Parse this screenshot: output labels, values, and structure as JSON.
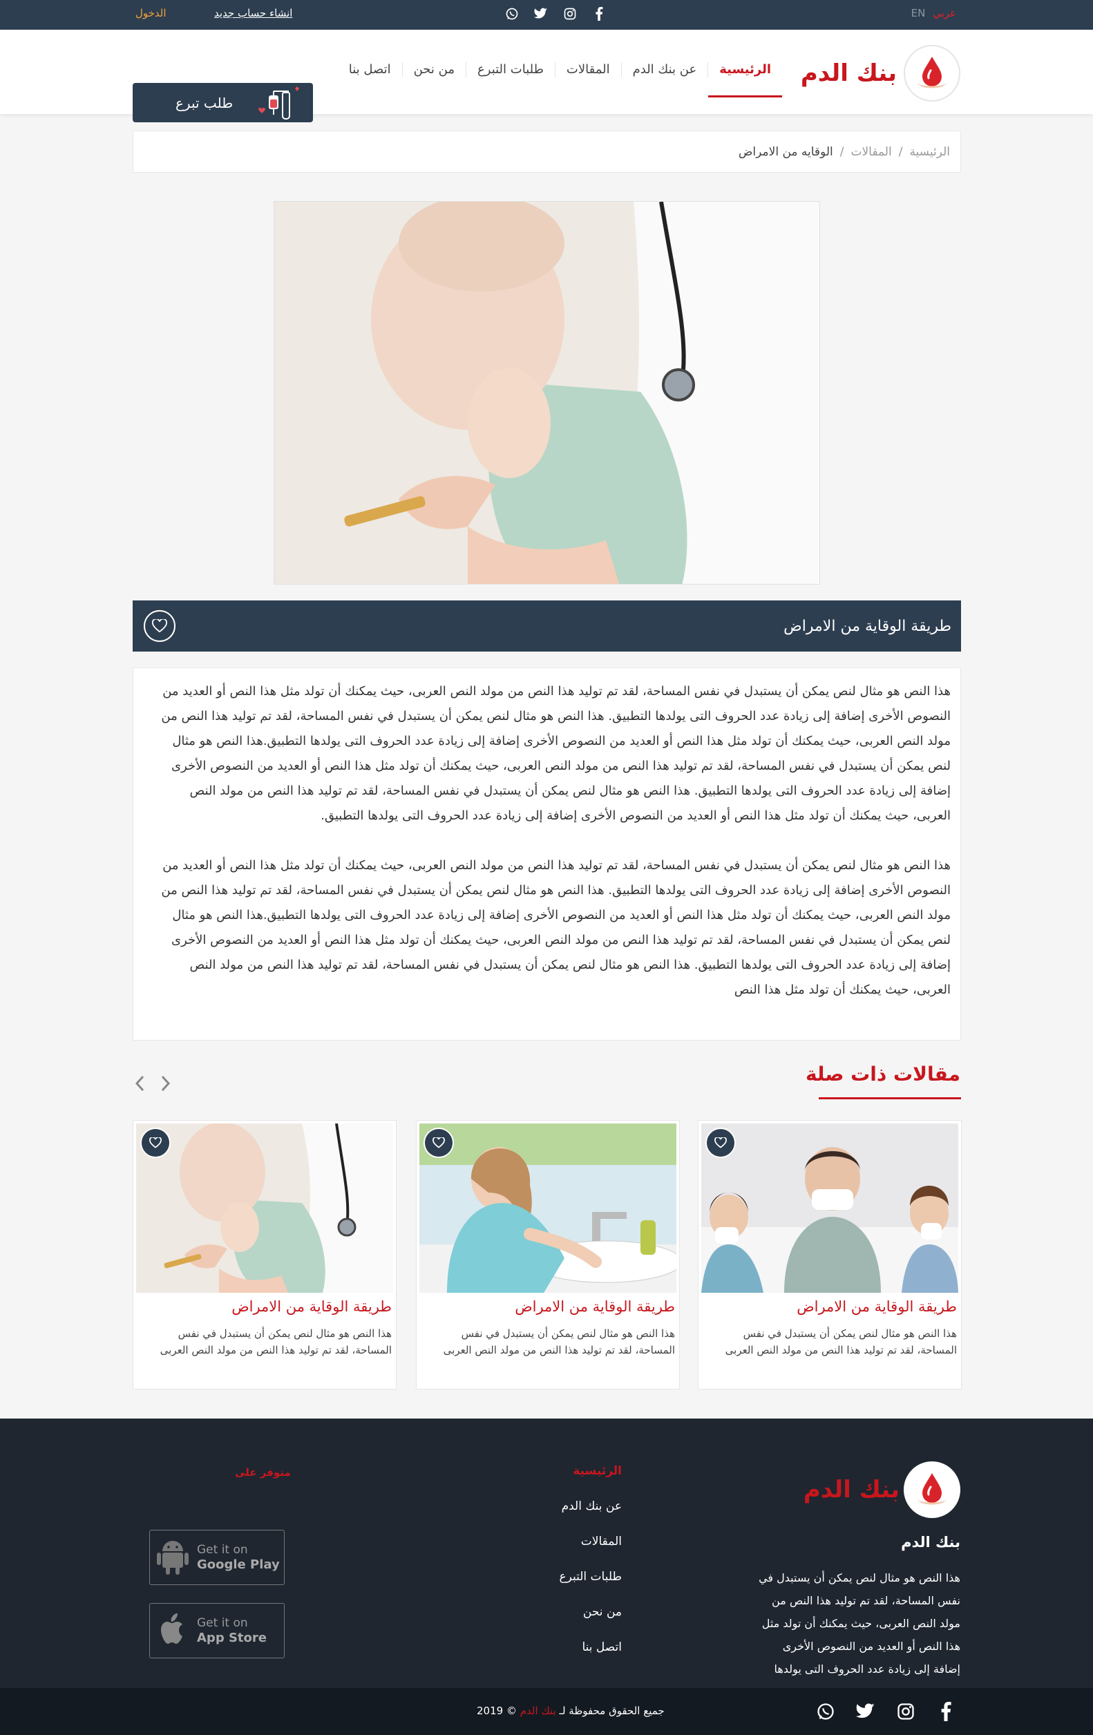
{
  "topbar": {
    "lang_en": "EN",
    "lang_ar": "عربي",
    "register": "انشاء حساب جديد",
    "login": "الدخول",
    "social_icons": [
      "facebook-icon",
      "instagram-icon",
      "twitter-icon",
      "whatsapp-icon"
    ]
  },
  "header": {
    "logo_text": "بنك الدم",
    "nav": [
      "الرئيسية",
      "عن بنك الدم",
      "المقالات",
      "طلبات التبرع",
      "من نحن",
      "اتصل بنا"
    ],
    "donate_button": "طلب تبرع"
  },
  "breadcrumb": [
    "الرئيسية",
    "المقالات",
    "الوقايه من الامراض"
  ],
  "breadcrumb_sep": "/",
  "article": {
    "title": "طريقة الوقاية من الامراض",
    "paragraph1": "هذا النص هو مثال لنص يمكن أن يستبدل في نفس المساحة، لقد تم توليد هذا النص من مولد النص العربى، حيث يمكنك أن تولد مثل هذا النص أو العديد من النصوص الأخرى إضافة إلى زيادة عدد الحروف التى يولدها التطبيق. هذا النص هو مثال لنص يمكن أن يستبدل في نفس المساحة، لقد تم توليد هذا النص من مولد النص العربى، حيث يمكنك أن تولد مثل هذا النص أو العديد من النصوص الأخرى إضافة إلى زيادة عدد الحروف التى يولدها التطبيق.هذا النص هو مثال لنص يمكن أن يستبدل في نفس المساحة، لقد تم توليد هذا النص من مولد النص العربى، حيث يمكنك أن تولد مثل هذا النص أو العديد من النصوص الأخرى إضافة إلى زيادة عدد الحروف التى يولدها التطبيق. هذا النص هو مثال لنص يمكن أن يستبدل في نفس المساحة، لقد تم توليد هذا النص من مولد النص العربى، حيث يمكنك أن تولد مثل هذا النص أو العديد من النصوص الأخرى إضافة إلى زيادة عدد الحروف التى يولدها التطبيق.",
    "paragraph2": "هذا النص هو مثال لنص يمكن أن يستبدل في نفس المساحة، لقد تم توليد هذا النص من مولد النص العربى، حيث يمكنك أن تولد مثل هذا النص أو العديد من النصوص الأخرى إضافة إلى زيادة عدد الحروف التى يولدها التطبيق. هذا النص هو مثال لنص يمكن أن يستبدل في نفس المساحة، لقد تم توليد هذا النص من مولد النص العربى، حيث يمكنك أن تولد مثل هذا النص أو العديد من النصوص الأخرى إضافة إلى زيادة عدد الحروف التى يولدها التطبيق.هذا النص هو مثال لنص يمكن أن يستبدل في نفس المساحة، لقد تم توليد هذا النص من مولد النص العربى، حيث يمكنك أن تولد مثل هذا النص أو العديد من النصوص الأخرى إضافة إلى زيادة عدد الحروف التى يولدها التطبيق. هذا النص هو مثال لنص يمكن أن يستبدل في نفس المساحة، لقد تم توليد هذا النص من مولد النص العربى، حيث يمكنك أن تولد مثل هذا النص"
  },
  "related": {
    "title": "مقالات ذات صلة",
    "cards": [
      {
        "title": "طريقة الوقاية من الامراض",
        "desc": "هذا النص هو مثال لنص يمكن أن يستبدل في نفس المساحة، لقد تم توليد هذا النص من مولد النص العربى"
      },
      {
        "title": "طريقة الوقاية من الامراض",
        "desc": "هذا النص هو مثال لنص يمكن أن يستبدل في نفس المساحة، لقد تم توليد هذا النص من مولد النص العربى"
      },
      {
        "title": "طريقة الوقاية من الامراض",
        "desc": "هذا النص هو مثال لنص يمكن أن يستبدل في نفس المساحة، لقد تم توليد هذا النص من مولد النص العربى"
      }
    ]
  },
  "footer": {
    "logo_text": "بنك الدم",
    "name": "بنك الدم",
    "desc": "هذا النص هو مثال لنص يمكن أن يستبدل في نفس المساحة، لقد تم توليد هذا النص من مولد النص العربى، حيث يمكنك أن تولد مثل هذا النص أو العديد من النصوص الأخرى إضافة إلى زيادة عدد الحروف التى يولدها",
    "links": [
      "الرئيسية",
      "عن بنك الدم",
      "المقالات",
      "طلبات التبرع",
      "من نحن",
      "اتصل بنا"
    ],
    "available_on": "متوفر على",
    "google_play": {
      "line1": "Get it on",
      "line2": "Google Play"
    },
    "app_store": {
      "line1": "Get it on",
      "line2": "App Store"
    },
    "copyright_text": "جميع الحقوق محفوظة لـ",
    "copyright_brand": "بنك الدم",
    "copyright_symbol": "©",
    "year": "2019"
  },
  "colors": {
    "navy": "#2d3e50",
    "red": "#c8161d",
    "footer": "#1f2630",
    "copybar": "#141a21"
  }
}
